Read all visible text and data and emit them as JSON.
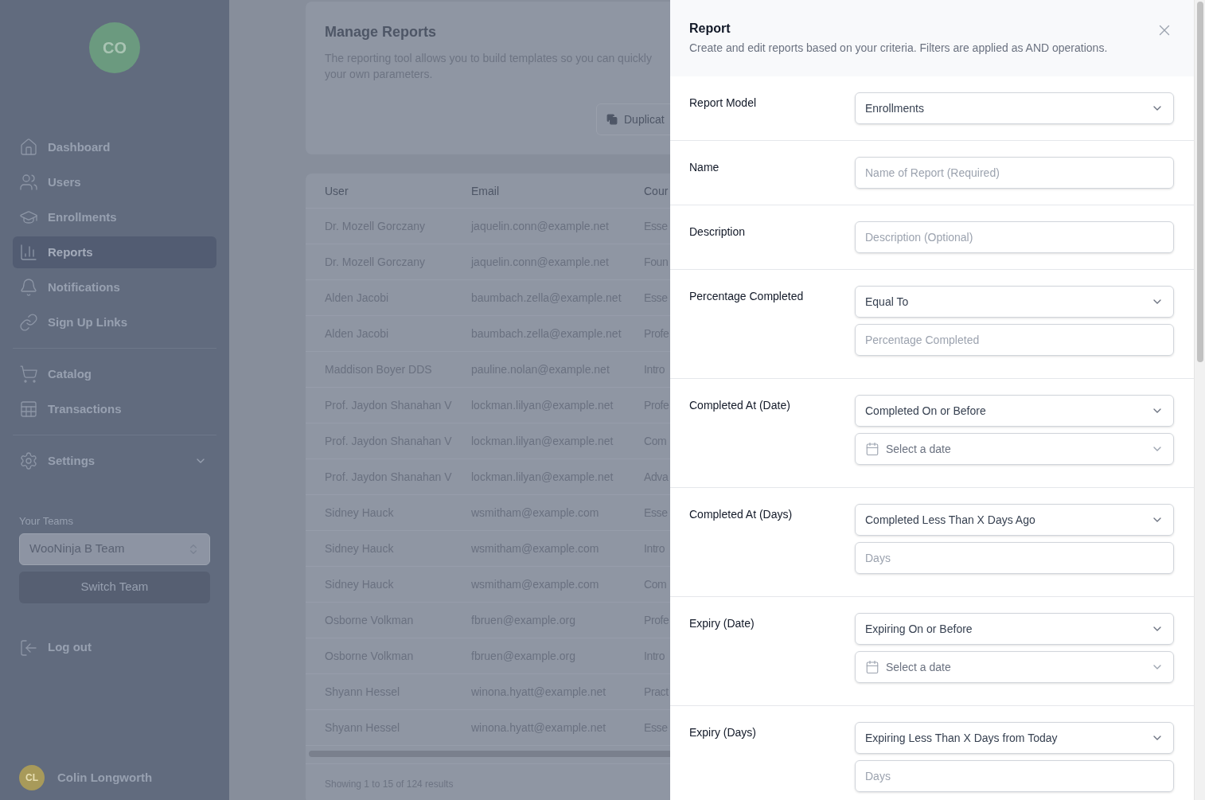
{
  "sidebar": {
    "logo_initials": "CO",
    "nav_groups": [
      [
        {
          "label": "Dashboard",
          "selected": false
        },
        {
          "label": "Users",
          "selected": false
        },
        {
          "label": "Enrollments",
          "selected": false
        },
        {
          "label": "Reports",
          "selected": true
        },
        {
          "label": "Notifications",
          "selected": false
        },
        {
          "label": "Sign Up Links",
          "selected": false
        }
      ],
      [
        {
          "label": "Catalog",
          "selected": false
        },
        {
          "label": "Transactions",
          "selected": false
        }
      ],
      [
        {
          "label": "Settings",
          "selected": false,
          "expanded": false
        }
      ]
    ],
    "teams": {
      "label": "Your Teams",
      "value": "WooNinja B Team",
      "button": "Switch Team"
    },
    "logout": "Log out",
    "user": {
      "initials": "CL",
      "name": "Colin Longworth"
    }
  },
  "main": {
    "title": "Manage Reports",
    "description": "The reporting tool allows you to build templates so you can quickly your own parameters.",
    "button": "Duplicat",
    "table": {
      "columns": [
        "User",
        "Email",
        "Cour"
      ],
      "rows": [
        [
          "Dr. Mozell Gorczany",
          "jaquelin.conn@example.net",
          "Esse"
        ],
        [
          "Dr. Mozell Gorczany",
          "jaquelin.conn@example.net",
          "Foun"
        ],
        [
          "Alden Jacobi",
          "baumbach.zella@example.net",
          "Esse"
        ],
        [
          "Alden Jacobi",
          "baumbach.zella@example.net",
          "Profe"
        ],
        [
          "Maddison Boyer DDS",
          "pauline.nolan@example.net",
          "Intro"
        ],
        [
          "Prof. Jaydon Shanahan V",
          "lockman.lilyan@example.net",
          "Profe"
        ],
        [
          "Prof. Jaydon Shanahan V",
          "lockman.lilyan@example.net",
          "Com"
        ],
        [
          "Prof. Jaydon Shanahan V",
          "lockman.lilyan@example.net",
          "Adva"
        ],
        [
          "Sidney Hauck",
          "wsmitham@example.com",
          "Esse"
        ],
        [
          "Sidney Hauck",
          "wsmitham@example.com",
          "Intro"
        ],
        [
          "Sidney Hauck",
          "wsmitham@example.com",
          "Com"
        ],
        [
          "Osborne Volkman",
          "fbruen@example.org",
          "Profe"
        ],
        [
          "Osborne Volkman",
          "fbruen@example.org",
          "Intro"
        ],
        [
          "Shyann Hessel",
          "winona.hyatt@example.net",
          "Pract"
        ],
        [
          "Shyann Hessel",
          "winona.hyatt@example.net",
          "Esse"
        ]
      ],
      "footer": "Showing 1 to 15 of 124 results"
    }
  },
  "panel": {
    "title": "Report",
    "subtitle": "Create and edit reports based on your criteria. Filters are applied as AND operations.",
    "fields": [
      {
        "label": "Report Model",
        "controls": [
          {
            "kind": "select",
            "value": "Enrollments"
          }
        ]
      },
      {
        "label": "Name",
        "controls": [
          {
            "kind": "input",
            "placeholder": "Name of Report (Required)"
          }
        ]
      },
      {
        "label": "Description",
        "controls": [
          {
            "kind": "input",
            "placeholder": "Description (Optional)"
          }
        ]
      },
      {
        "label": "Percentage Completed",
        "controls": [
          {
            "kind": "select",
            "value": "Equal To"
          },
          {
            "kind": "input",
            "placeholder": "Percentage Completed"
          }
        ]
      },
      {
        "label": "Completed At (Date)",
        "controls": [
          {
            "kind": "select",
            "value": "Completed On or Before"
          },
          {
            "kind": "date",
            "placeholder": "Select a date"
          }
        ]
      },
      {
        "label": "Completed At (Days)",
        "controls": [
          {
            "kind": "select",
            "value": "Completed Less Than X Days Ago"
          },
          {
            "kind": "input",
            "placeholder": "Days"
          }
        ]
      },
      {
        "label": "Expiry (Date)",
        "controls": [
          {
            "kind": "select",
            "value": "Expiring On or Before"
          },
          {
            "kind": "date",
            "placeholder": "Select a date"
          }
        ]
      },
      {
        "label": "Expiry (Days)",
        "controls": [
          {
            "kind": "select",
            "value": "Expiring Less Than X Days from Today"
          },
          {
            "kind": "input",
            "placeholder": "Days"
          }
        ]
      }
    ]
  }
}
